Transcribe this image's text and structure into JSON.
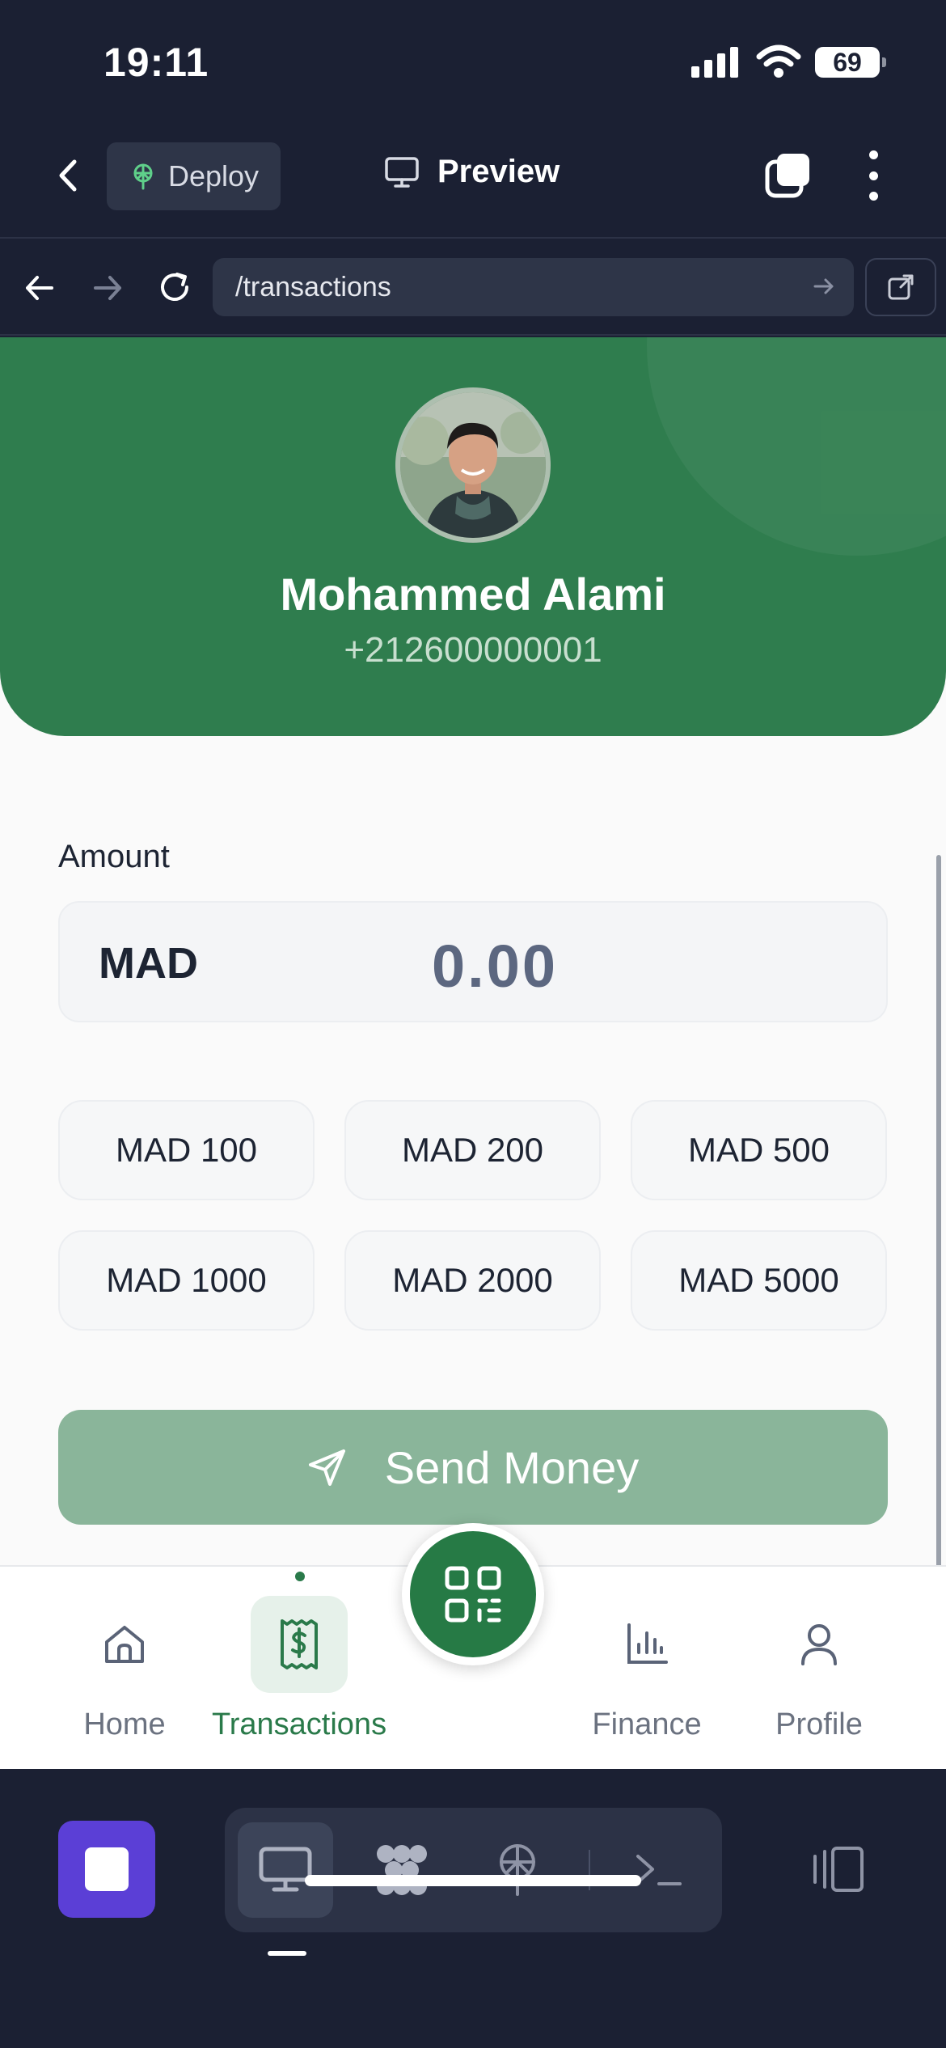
{
  "status": {
    "time": "19:11",
    "battery": "69"
  },
  "appbar": {
    "deploy_label": "Deploy",
    "preview_label": "Preview"
  },
  "browser": {
    "url": "/transactions"
  },
  "profile": {
    "name": "Mohammed Alami",
    "phone": "+212600000001"
  },
  "amount": {
    "label": "Amount",
    "currency": "MAD",
    "value": "0.00"
  },
  "quick_amounts": [
    "MAD 100",
    "MAD 200",
    "MAD 500",
    "MAD 1000",
    "MAD 2000",
    "MAD 5000"
  ],
  "send_button": {
    "label": "Send Money"
  },
  "bottom_nav": {
    "home": "Home",
    "transactions": "Transactions",
    "finance": "Finance",
    "profile": "Profile",
    "active": "transactions"
  },
  "colors": {
    "brand_green": "#2f7d4e",
    "send_button": "#8ab59a",
    "dock_stop": "#5b3fd6"
  }
}
